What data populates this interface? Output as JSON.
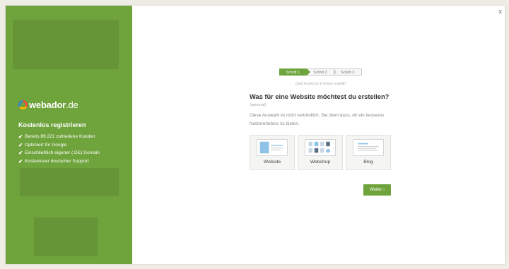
{
  "brand": {
    "name_bold": "webador",
    "name_rest": ".de"
  },
  "sidebar": {
    "title": "Kostenlos registrieren",
    "features": [
      "Bereits 89.221 zufriedene Kunden",
      "Optimiert für Google",
      "Einschließlich eigener (.DE) Domain",
      "Kostenloser deutscher Support"
    ]
  },
  "close_label": "x",
  "steps": [
    "Schritt 1",
    "Schritt 2",
    "Schritt 3"
  ],
  "subnote": "Dein Konto ist in Kürze erstellt!",
  "question": "Was für eine Website möchtest du erstellen?",
  "optional": "(optional)",
  "description": "Diese Auswahl ist nicht verbindlich. Sie dient dazu, dir ein besseres Nutzererlebnis zu bieten.",
  "options": [
    "Website",
    "Webshop",
    "Blog"
  ],
  "next_label": "Weiter ›",
  "colors": {
    "accent": "#6fa33c",
    "thumb_blue": "#8ec3e8",
    "page_bg": "#efece6"
  }
}
